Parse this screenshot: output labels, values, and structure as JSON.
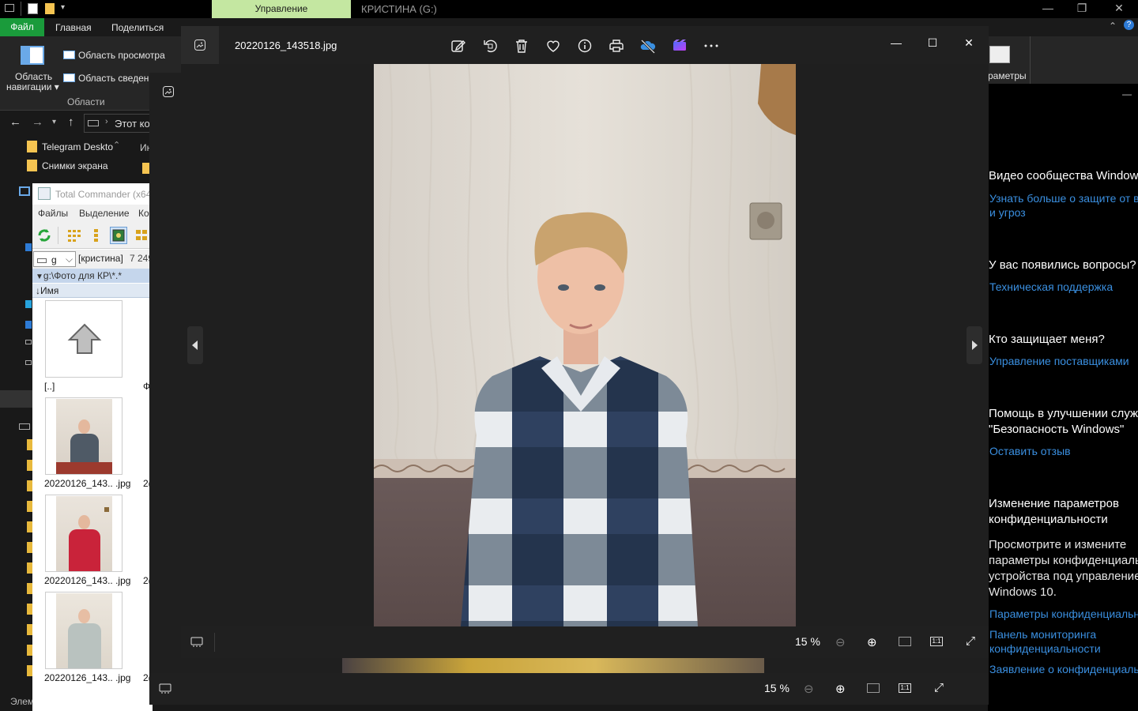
{
  "explorer": {
    "ribbon_context_tab": "Управление",
    "window_title": "КРИСТИНА (G:)",
    "tabs": {
      "file": "Файл",
      "home": "Главная",
      "share": "Поделиться"
    },
    "nav_pane_label_1": "Область",
    "nav_pane_label_2": "навигации",
    "preview_pane": "Область просмотра",
    "details_pane": "Область сведени",
    "group_label": "Области",
    "params_label": "раметры",
    "address": "Этот ко",
    "sidebar_items": [
      "Telegram Deskto",
      "Снимки экрана"
    ],
    "col_header_partial": "Ин",
    "status_text": "Элем"
  },
  "security": {
    "h1": "Видео сообщества Windows",
    "l1a": "Узнать больше о защите от в",
    "l1b": "и угроз",
    "h2": "У вас появились вопросы?",
    "l2": "Техническая поддержка",
    "h3": "Кто защищает меня?",
    "l3": "Управление поставщиками",
    "h4a": "Помощь в улучшении служ",
    "h4b": "\"Безопасность Windows\"",
    "l4": "Оставить отзыв",
    "h5a": "Изменение параметров",
    "h5b": "конфиденциальности",
    "p5a": "Просмотрите и измените",
    "p5b": "параметры конфиденциальн",
    "p5c": "устройства под управление",
    "p5d": "Windows 10.",
    "l5a": "Параметры конфиденциальн",
    "l5b": "Панель мониторинга",
    "l5c": "конфиденциальности",
    "l5d": "Заявление о конфиденциаль"
  },
  "tc": {
    "title": "Total Commander (x64",
    "menu": [
      "Файлы",
      "Выделение",
      "Ко"
    ],
    "drive": "g",
    "volume": "[кристина]",
    "free": "7 249",
    "path": "g:\\Фото для КР\\*.*",
    "col_name": "↓Имя",
    "up_label": "[..]",
    "files": [
      "20220126_143.. .jpg",
      "20220126_143.. .jpg",
      "20220126_143.. .jpg"
    ],
    "partial": [
      "Ф",
      "2(",
      "2(",
      "2("
    ]
  },
  "photos": {
    "filename": "20220126_143518.jpg",
    "zoom": "15 %",
    "back_zoom": "15 %",
    "icons": [
      "edit-icon",
      "rotate-icon",
      "delete-icon",
      "favorite-icon",
      "info-icon",
      "print-icon",
      "onedrive-icon",
      "video-editor-icon",
      "more-icon"
    ]
  }
}
